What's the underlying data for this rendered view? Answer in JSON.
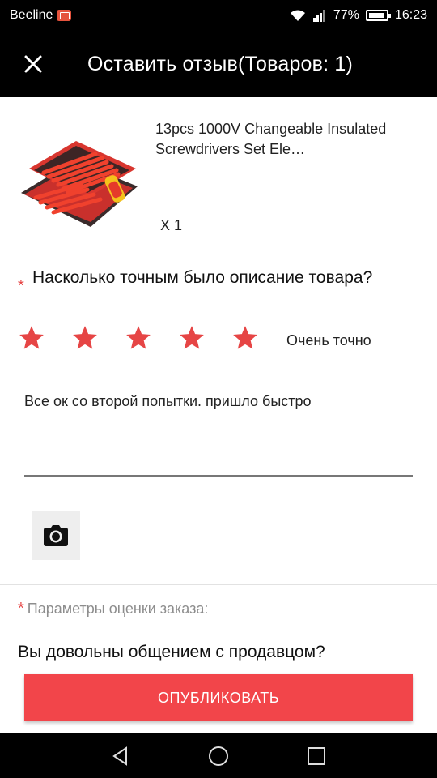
{
  "status_bar": {
    "carrier": "Beeline",
    "battery": "77%",
    "time": "16:23"
  },
  "header": {
    "close_icon": "close-icon",
    "title": "Оставить отзыв(Товаров: 1)"
  },
  "product": {
    "title": "13pcs 1000V Changeable Insulated Screwdrivers Set Ele…",
    "quantity": "X 1"
  },
  "rating": {
    "required_mark": "*",
    "question": "Насколько точным было описание товара?",
    "stars": 5,
    "max_stars": 5,
    "label": "Очень точно",
    "star_color": "#e64545"
  },
  "review": {
    "text": "Все ок со второй попытки. пришло быстро"
  },
  "photo": {
    "icon": "camera-icon"
  },
  "params": {
    "required_mark": "*",
    "label": "Параметры оценки заказа:"
  },
  "seller_question": "Вы довольны общением с продавцом?",
  "publish_button": "ОПУБЛИКОВАТЬ",
  "colors": {
    "accent": "#f2454a",
    "bar": "#000000"
  }
}
